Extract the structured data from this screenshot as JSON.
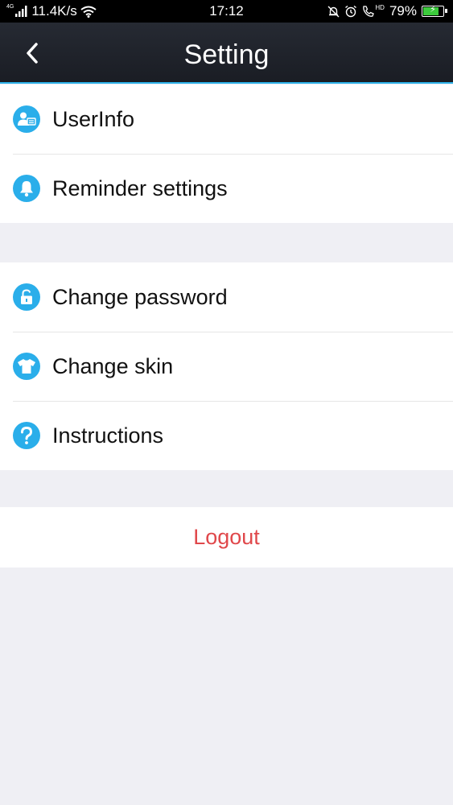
{
  "status_bar": {
    "network_type": "4G",
    "speed": "11.4K/s",
    "time": "17:12",
    "hd_label": "HD",
    "battery_percent": "79%",
    "battery_level": 0.79
  },
  "header": {
    "title": "Setting",
    "back_icon": "chevron-left-icon"
  },
  "groups": [
    {
      "items": [
        {
          "label": "UserInfo",
          "icon": "user-card-icon"
        },
        {
          "label": "Reminder settings",
          "icon": "bell-icon"
        }
      ]
    },
    {
      "items": [
        {
          "label": "Change password",
          "icon": "lock-icon"
        },
        {
          "label": "Change skin",
          "icon": "tshirt-icon"
        },
        {
          "label": "Instructions",
          "icon": "question-icon"
        }
      ]
    }
  ],
  "logout": {
    "label": "Logout"
  },
  "colors": {
    "accent": "#2aaeea",
    "logout": "#e0484b",
    "background": "#efeff4",
    "header": "#1f222a"
  }
}
